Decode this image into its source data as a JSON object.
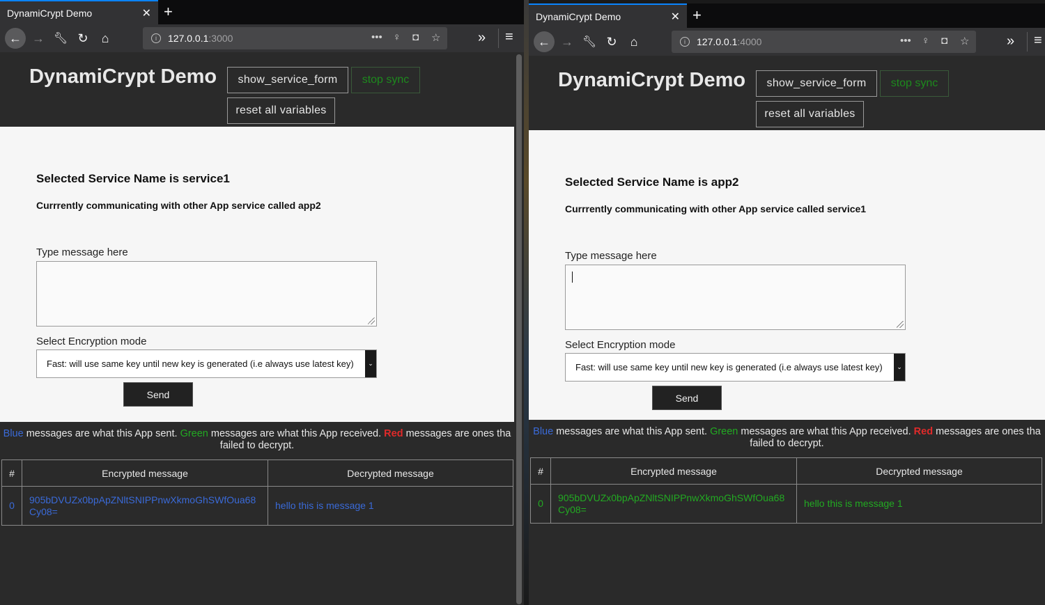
{
  "windows": [
    {
      "tab_title": "DynamiCrypt Demo",
      "url_host": "127.0.0.1",
      "url_port": ":3000",
      "app_title": "DynamiCrypt Demo",
      "show_form_label": "show_service_form",
      "stop_sync_label": "stop sync",
      "reset_label": "reset all variables",
      "service_heading": "Selected Service Name is service1",
      "communicating": "Currrently communicating with other App service called app2",
      "message_label": "Type message here",
      "message_value": "",
      "encryption_label": "Select Encryption mode",
      "encryption_selected": "Fast: will use same key until new key is generated (i.e always use latest key)",
      "send_label": "Send",
      "legend": {
        "blue": "Blue",
        "blue_text": " messages are what this App sent. ",
        "green": "Green",
        "green_text": " messages are what this App received. ",
        "red": "Red",
        "red_text": " messages are ones tha",
        "line2": "failed to decrypt."
      },
      "table": {
        "headers": [
          "#",
          "Encrypted message",
          "Decrypted message"
        ],
        "rows": [
          {
            "index": "0",
            "encrypted": "905bDVUZx0bpApZNltSNIPPnwXkmoGhSWfOua68 Cy08=",
            "decrypted": "hello this is message 1",
            "status": "sent"
          }
        ]
      }
    },
    {
      "tab_title": "DynamiCrypt Demo",
      "url_host": "127.0.0.1",
      "url_port": ":4000",
      "app_title": "DynamiCrypt Demo",
      "show_form_label": "show_service_form",
      "stop_sync_label": "stop sync",
      "reset_label": "reset all variables",
      "service_heading": "Selected Service Name is app2",
      "communicating": "Currrently communicating with other App service called service1",
      "message_label": "Type message here",
      "message_value": "",
      "encryption_label": "Select Encryption mode",
      "encryption_selected": "Fast: will use same key until new key is generated (i.e always use latest key)",
      "send_label": "Send",
      "legend": {
        "blue": "Blue",
        "blue_text": " messages are what this App sent. ",
        "green": "Green",
        "green_text": " messages are what this App received. ",
        "red": "Red",
        "red_text": " messages are ones tha",
        "line2": "failed to decrypt."
      },
      "table": {
        "headers": [
          "#",
          "Encrypted message",
          "Decrypted message"
        ],
        "rows": [
          {
            "index": "0",
            "encrypted": "905bDVUZx0bpApZNltSNIPPnwXkmoGhSWfOua68 Cy08=",
            "decrypted": "hello this is message 1",
            "status": "received"
          }
        ]
      }
    }
  ],
  "icons": [
    "back-icon",
    "forward-icon",
    "wrench-icon",
    "reload-icon",
    "home-icon",
    "info-icon",
    "more-icon",
    "bulb-icon",
    "pocket-icon",
    "star-icon",
    "overflow-icon",
    "menu-icon",
    "close-icon",
    "plus-icon",
    "dropdown-arrow-icon"
  ],
  "colors": {
    "sent": "#3a6ad8",
    "received": "#22aa22",
    "failed": "#e02a2a",
    "tab_accent": "#0a84ff"
  }
}
